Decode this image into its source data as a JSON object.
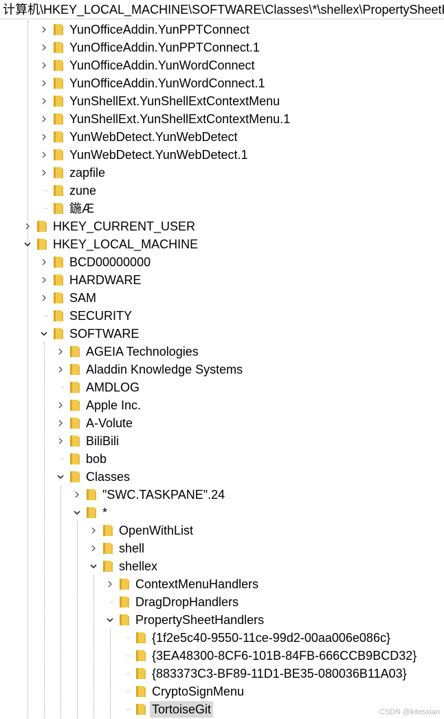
{
  "address_bar": {
    "path": "计算机\\HKEY_LOCAL_MACHINE\\SOFTWARE\\Classes\\*\\shellex\\PropertySheetHandlers"
  },
  "colors": {
    "folder": "#f2c94c",
    "selected_bg": "#d9d9d9",
    "guide": "#a0a0a0"
  },
  "tree": {
    "nodes": [
      {
        "label": "YunOfficeAddin.YunPPTConnect",
        "level": 2,
        "state": "collapsed",
        "icon": "folder-icon"
      },
      {
        "label": "YunOfficeAddin.YunPPTConnect.1",
        "level": 2,
        "state": "collapsed",
        "icon": "folder-icon"
      },
      {
        "label": "YunOfficeAddin.YunWordConnect",
        "level": 2,
        "state": "collapsed",
        "icon": "folder-icon"
      },
      {
        "label": "YunOfficeAddin.YunWordConnect.1",
        "level": 2,
        "state": "collapsed",
        "icon": "folder-icon"
      },
      {
        "label": "YunShellExt.YunShellExtContextMenu",
        "level": 2,
        "state": "collapsed",
        "icon": "folder-icon"
      },
      {
        "label": "YunShellExt.YunShellExtContextMenu.1",
        "level": 2,
        "state": "collapsed",
        "icon": "folder-icon"
      },
      {
        "label": "YunWebDetect.YunWebDetect",
        "level": 2,
        "state": "collapsed",
        "icon": "folder-icon"
      },
      {
        "label": "YunWebDetect.YunWebDetect.1",
        "level": 2,
        "state": "collapsed",
        "icon": "folder-icon"
      },
      {
        "label": "zapfile",
        "level": 2,
        "state": "collapsed",
        "icon": "folder-icon"
      },
      {
        "label": "zune",
        "level": 2,
        "state": "leaf",
        "icon": "folder-icon"
      },
      {
        "label": "鍦Æ",
        "level": 2,
        "state": "leaf",
        "icon": "folder-icon"
      },
      {
        "label": "HKEY_CURRENT_USER",
        "level": 1,
        "state": "collapsed",
        "icon": "folder-icon"
      },
      {
        "label": "HKEY_LOCAL_MACHINE",
        "level": 1,
        "state": "expanded",
        "icon": "folder-icon"
      },
      {
        "label": "BCD00000000",
        "level": 2,
        "state": "collapsed",
        "icon": "folder-icon"
      },
      {
        "label": "HARDWARE",
        "level": 2,
        "state": "collapsed",
        "icon": "folder-icon"
      },
      {
        "label": "SAM",
        "level": 2,
        "state": "collapsed",
        "icon": "folder-icon"
      },
      {
        "label": "SECURITY",
        "level": 2,
        "state": "leaf",
        "icon": "folder-icon"
      },
      {
        "label": "SOFTWARE",
        "level": 2,
        "state": "expanded",
        "icon": "folder-icon"
      },
      {
        "label": "AGEIA Technologies",
        "level": 3,
        "state": "collapsed",
        "icon": "folder-icon"
      },
      {
        "label": "Aladdin Knowledge Systems",
        "level": 3,
        "state": "collapsed",
        "icon": "folder-icon"
      },
      {
        "label": "AMDLOG",
        "level": 3,
        "state": "leaf",
        "icon": "folder-icon"
      },
      {
        "label": "Apple Inc.",
        "level": 3,
        "state": "collapsed",
        "icon": "folder-icon"
      },
      {
        "label": "A-Volute",
        "level": 3,
        "state": "collapsed",
        "icon": "folder-icon"
      },
      {
        "label": "BiliBili",
        "level": 3,
        "state": "collapsed",
        "icon": "folder-icon"
      },
      {
        "label": "bob",
        "level": 3,
        "state": "leaf",
        "icon": "folder-icon"
      },
      {
        "label": "Classes",
        "level": 3,
        "state": "expanded",
        "icon": "folder-icon"
      },
      {
        "label": "\"SWC.TASKPANE\".24",
        "level": 4,
        "state": "collapsed",
        "icon": "folder-icon"
      },
      {
        "label": "*",
        "level": 4,
        "state": "expanded",
        "icon": "folder-icon"
      },
      {
        "label": "OpenWithList",
        "level": 5,
        "state": "collapsed",
        "icon": "folder-icon"
      },
      {
        "label": "shell",
        "level": 5,
        "state": "collapsed",
        "icon": "folder-icon"
      },
      {
        "label": "shellex",
        "level": 5,
        "state": "expanded",
        "icon": "folder-icon"
      },
      {
        "label": "ContextMenuHandlers",
        "level": 6,
        "state": "collapsed",
        "icon": "folder-icon"
      },
      {
        "label": "DragDropHandlers",
        "level": 6,
        "state": "leaf",
        "icon": "folder-icon"
      },
      {
        "label": "PropertySheetHandlers",
        "level": 6,
        "state": "expanded",
        "icon": "folder-icon"
      },
      {
        "label": "{1f2e5c40-9550-11ce-99d2-00aa006e086c}",
        "level": 7,
        "state": "leaf",
        "icon": "folder-icon"
      },
      {
        "label": "{3EA48300-8CF6-101B-84FB-666CCB9BCD32}",
        "level": 7,
        "state": "leaf",
        "icon": "folder-icon"
      },
      {
        "label": "{883373C3-BF89-11D1-BE35-080036B11A03}",
        "level": 7,
        "state": "leaf",
        "icon": "folder-icon"
      },
      {
        "label": "CryptoSignMenu",
        "level": 7,
        "state": "leaf",
        "icon": "folder-icon"
      },
      {
        "label": "TortoiseGit",
        "level": 7,
        "state": "leaf",
        "icon": "folder-icon",
        "selected": true
      }
    ]
  },
  "watermark": "CSDN @kitesxian"
}
